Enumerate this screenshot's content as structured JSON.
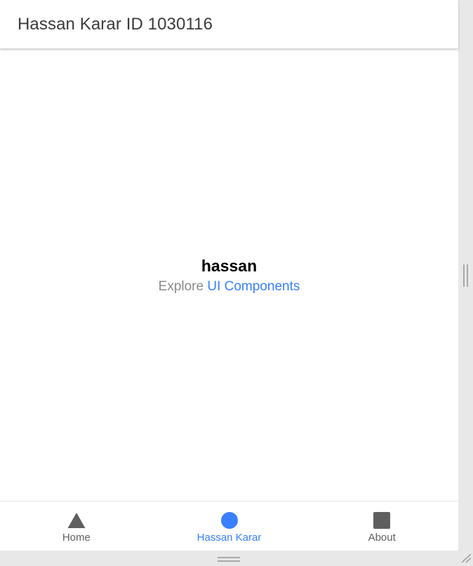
{
  "header": {
    "title": "Hassan Karar ID 1030116"
  },
  "main": {
    "title": "hassan",
    "subtitle_prefix": "Explore",
    "subtitle_link": "UI Components"
  },
  "tabs": [
    {
      "label": "Home",
      "icon": "triangle-icon",
      "selected": false,
      "color": "#5f5f5f"
    },
    {
      "label": "Hassan Karar",
      "icon": "circle-icon",
      "selected": true,
      "color": "#3880ff"
    },
    {
      "label": "About",
      "icon": "square-icon",
      "selected": false,
      "color": "#5f5f5f"
    }
  ],
  "colors": {
    "accent": "#3880ff",
    "icon_inactive": "#5f5f5f",
    "text_muted": "#8a8a8a"
  }
}
